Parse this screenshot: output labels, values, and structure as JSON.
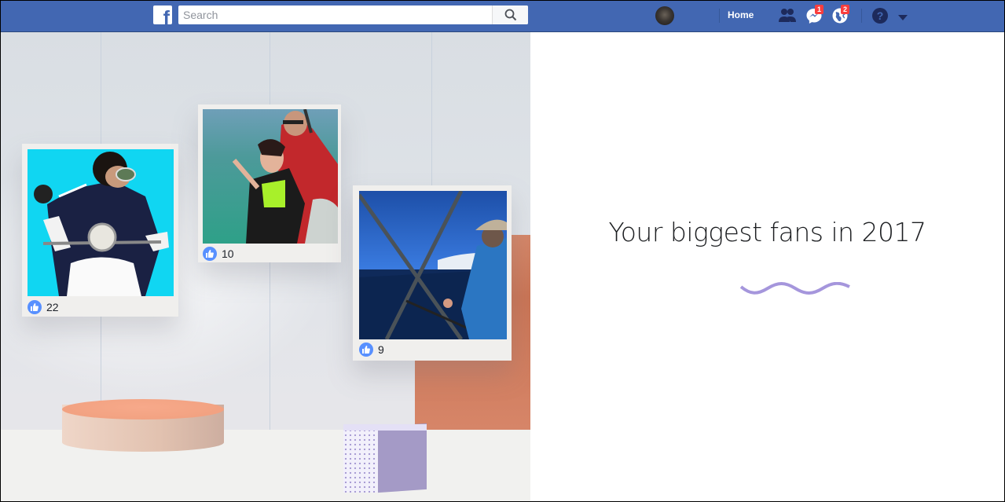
{
  "topbar": {
    "logo": "f",
    "search": {
      "placeholder": "Search",
      "value": ""
    },
    "home_label": "Home",
    "badges": {
      "messages": "1",
      "notifications": "2"
    },
    "icons": [
      "facebook-logo-icon",
      "search-icon",
      "avatar",
      "friend-requests-icon",
      "messenger-icon",
      "notifications-globe-icon",
      "help-icon",
      "dropdown-caret-icon"
    ]
  },
  "scene": {
    "photos": [
      {
        "subject": "man on scooter with goggles",
        "likes": "22"
      },
      {
        "subject": "tandem skydivers",
        "likes": "10"
      },
      {
        "subject": "man fishing on boat",
        "likes": "9"
      }
    ]
  },
  "right": {
    "headline": "Your biggest fans in 2017",
    "accent_color": "#a596dc"
  }
}
